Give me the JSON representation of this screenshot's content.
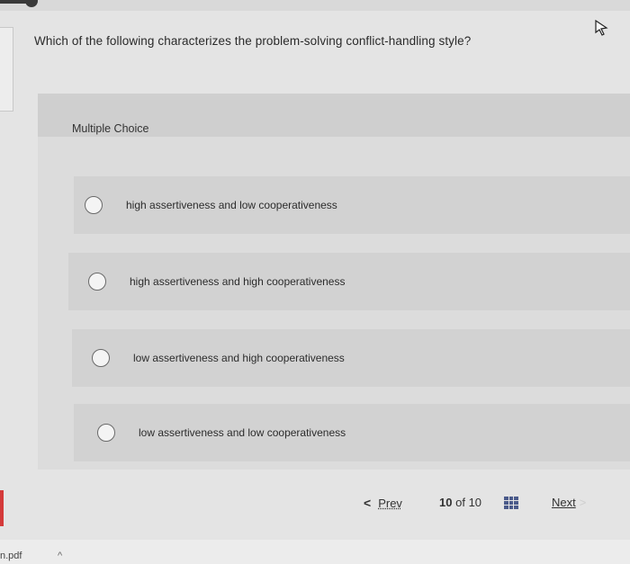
{
  "question": {
    "text": "Which of the following characterizes the problem-solving conflict-handling style?"
  },
  "multiple_choice": {
    "label": "Multiple Choice",
    "options": [
      {
        "text": "high assertiveness and low cooperativeness",
        "selected": false
      },
      {
        "text": "high assertiveness and high cooperativeness",
        "selected": false
      },
      {
        "text": "low assertiveness and high cooperativeness",
        "selected": false
      },
      {
        "text": "low assertiveness and low cooperativeness",
        "selected": false
      }
    ]
  },
  "navigation": {
    "prev_chevron": "<",
    "prev_label": "Prev",
    "current_page": "10",
    "of_label": "of",
    "total_pages": "10",
    "grid_icon": "grid-icon",
    "next_label": "Next",
    "next_chevron": ">"
  },
  "footer": {
    "file_label": "n.pdf",
    "caret": "^"
  },
  "icons": {
    "cursor": "mouse-cursor-icon"
  },
  "colors": {
    "grid_icon": "#4a5a8a",
    "red_strip": "#d43a3a"
  }
}
